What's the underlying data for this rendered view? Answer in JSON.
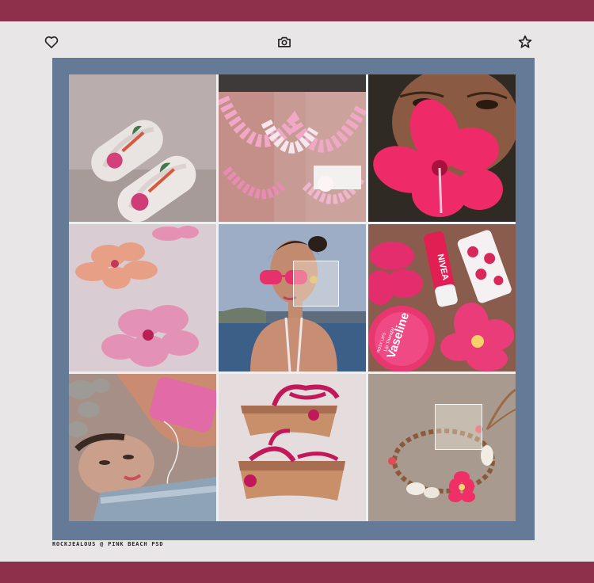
{
  "colors": {
    "background": "#e8e6e7",
    "band": "#8e2f4c",
    "frame": "#657a96",
    "icon": "#222222"
  },
  "toolbar": {
    "left_icon": "heart-icon",
    "center_icon": "camera-icon",
    "right_icon": "star-icon"
  },
  "collage": {
    "tiles": [
      {
        "subject": "flip-flops-icon"
      },
      {
        "subject": "flower-leis-icon"
      },
      {
        "subject": "hibiscus-face-icon"
      },
      {
        "subject": "painted-hibiscus-icon"
      },
      {
        "subject": "portrait-sunglasses-icon"
      },
      {
        "subject": "lip-balm-products-icon",
        "labels": [
          "NIVEA",
          "Vaseline",
          "Lip Therapy",
          "ROSY LIPS"
        ]
      },
      {
        "subject": "lying-girl-icon"
      },
      {
        "subject": "wedge-sandals-icon"
      },
      {
        "subject": "shell-bracelet-icon"
      }
    ]
  },
  "credit": "rockjealous @ pink beach psd"
}
